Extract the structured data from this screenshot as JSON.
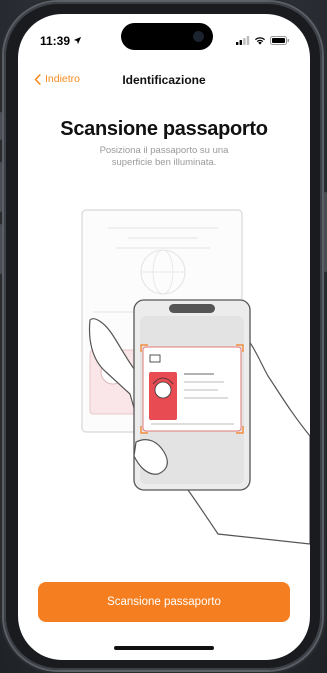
{
  "status_bar": {
    "time": "11:39"
  },
  "nav": {
    "back_label": "Indietro",
    "title": "Identificazione"
  },
  "main": {
    "heading": "Scansione passaporto",
    "subtitle": "Posiziona il passaporto su una superficie ben illuminata."
  },
  "cta": {
    "label": "Scansione passaporto"
  },
  "colors": {
    "accent": "#f57f20",
    "background": "#ffffff",
    "device": "#1a1b1e"
  },
  "icons": [
    "location-arrow-icon",
    "signal-icon",
    "wifi-icon",
    "battery-icon",
    "chevron-left-icon"
  ]
}
